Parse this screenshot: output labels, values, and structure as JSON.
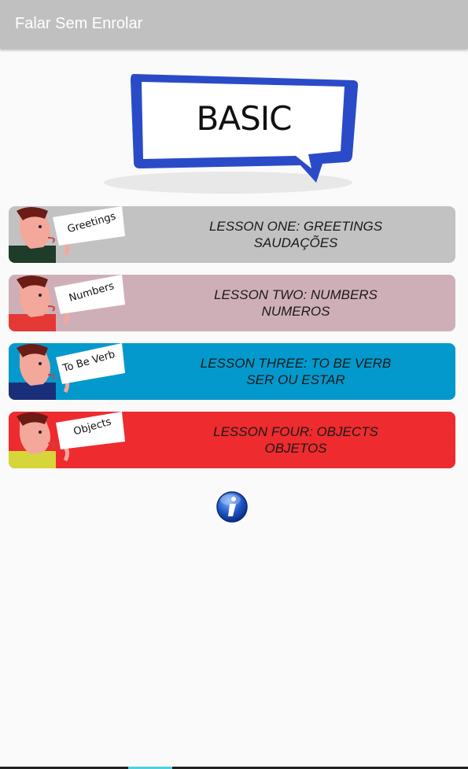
{
  "app": {
    "title": "Falar Sem Enrolar"
  },
  "banner": {
    "text": "BASIC"
  },
  "lessons": [
    {
      "sign": "Greetings",
      "line1": "LESSON ONE: GREETINGS",
      "line2": "SAUDAÇÕES",
      "color": "#c2c2c2",
      "shirt": "#1f3b2a"
    },
    {
      "sign": "Numbers",
      "line1": "LESSON TWO: NUMBERS",
      "line2": "NUMEROS",
      "color": "#cfafb7",
      "shirt": "#e53935"
    },
    {
      "sign": "To Be Verb",
      "line1": "LESSON THREE: TO BE VERB",
      "line2": "SER OU ESTAR",
      "color": "#0399cc",
      "shirt": "#1a2f7a"
    },
    {
      "sign": "Objects",
      "line1": "LESSON FOUR: OBJECTS",
      "line2": "OBJETOS",
      "color": "#ee2b2e",
      "shirt": "#d6d63a"
    }
  ],
  "info": {
    "icon": "info-icon"
  }
}
